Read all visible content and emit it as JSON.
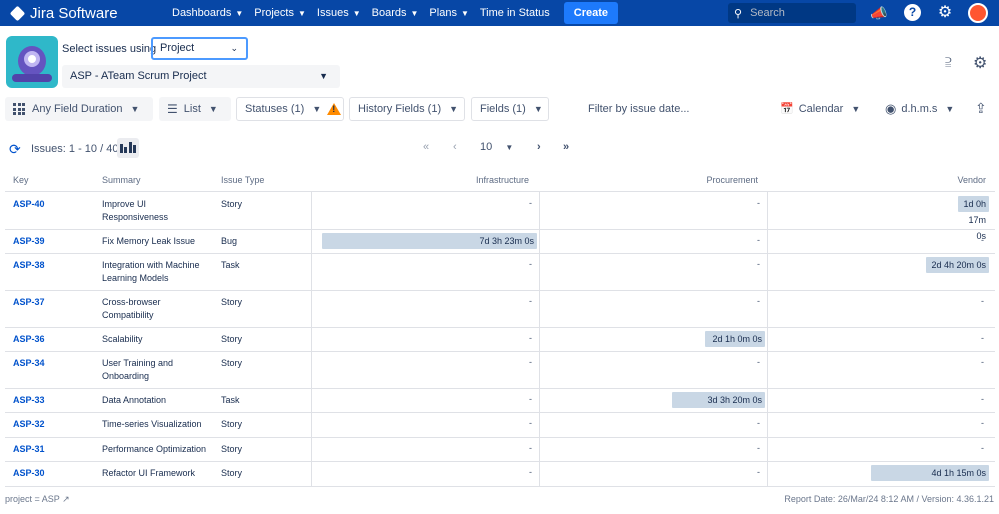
{
  "topnav": {
    "product": "Jira Software",
    "items": [
      "Dashboards",
      "Projects",
      "Issues",
      "Boards",
      "Plans"
    ],
    "time_in_status": "Time in Status",
    "create": "Create",
    "search_placeholder": "Search"
  },
  "header": {
    "select_label": "Select issues using",
    "select_value": "Project",
    "project": "ASP - ATeam Scrum Project"
  },
  "toolbar": {
    "duration": "Any Field Duration",
    "view": "List",
    "statuses": "Statuses (1)",
    "history_fields": "History Fields (1)",
    "fields": "Fields (1)",
    "filter_date": "Filter by issue date...",
    "calendar": "Calendar",
    "format": "d.h.m.s"
  },
  "pagination": {
    "issues": "Issues: 1 - 10 / 40",
    "page_size": "10"
  },
  "table": {
    "headers": [
      "Key",
      "Summary",
      "Issue Type",
      "Infrastructure",
      "Procurement",
      "Vendor"
    ],
    "rows": [
      {
        "key": "ASP-40",
        "summary": "Improve UI Responsiveness",
        "type": "Story",
        "infra": "-",
        "proc": "-",
        "vendor": "1d 0h 17m 0s",
        "infra_pct": 0,
        "proc_pct": 0,
        "vendor_pct": 0.14
      },
      {
        "key": "ASP-39",
        "summary": "Fix Memory Leak Issue",
        "type": "Bug",
        "infra": "7d 3h 23m 0s",
        "proc": "-",
        "vendor": "-",
        "infra_pct": 0.97,
        "proc_pct": 0,
        "vendor_pct": 0
      },
      {
        "key": "ASP-38",
        "summary": "Integration with Machine Learning Models",
        "type": "Task",
        "infra": "-",
        "proc": "-",
        "vendor": "2d 4h 20m 0s",
        "infra_pct": 0,
        "proc_pct": 0,
        "vendor_pct": 0.29
      },
      {
        "key": "ASP-37",
        "summary": "Cross-browser Compatibility",
        "type": "Story",
        "infra": "-",
        "proc": "-",
        "vendor": "-",
        "infra_pct": 0,
        "proc_pct": 0,
        "vendor_pct": 0
      },
      {
        "key": "ASP-36",
        "summary": "Scalability",
        "type": "Story",
        "infra": "-",
        "proc": "2d 1h 0m 0s",
        "vendor": "-",
        "infra_pct": 0,
        "proc_pct": 0.27,
        "vendor_pct": 0
      },
      {
        "key": "ASP-34",
        "summary": "User Training and Onboarding",
        "type": "Story",
        "infra": "-",
        "proc": "-",
        "vendor": "-",
        "infra_pct": 0,
        "proc_pct": 0,
        "vendor_pct": 0
      },
      {
        "key": "ASP-33",
        "summary": "Data Annotation",
        "type": "Task",
        "infra": "-",
        "proc": "3d 3h 20m 0s",
        "vendor": "-",
        "infra_pct": 0,
        "proc_pct": 0.42,
        "vendor_pct": 0
      },
      {
        "key": "ASP-32",
        "summary": "Time-series Visualization",
        "type": "Story",
        "infra": "-",
        "proc": "-",
        "vendor": "-",
        "infra_pct": 0,
        "proc_pct": 0,
        "vendor_pct": 0
      },
      {
        "key": "ASP-31",
        "summary": "Performance Optimization",
        "type": "Story",
        "infra": "-",
        "proc": "-",
        "vendor": "-",
        "infra_pct": 0,
        "proc_pct": 0,
        "vendor_pct": 0
      },
      {
        "key": "ASP-30",
        "summary": "Refactor UI Framework",
        "type": "Story",
        "infra": "-",
        "proc": "-",
        "vendor": "4d 1h 15m 0s",
        "infra_pct": 0,
        "proc_pct": 0,
        "vendor_pct": 0.54
      }
    ]
  },
  "footer": {
    "query": "project = ASP",
    "report": "Report Date: 26/Mar/24 8:12 AM / Version: 4.36.1.21"
  },
  "colors": {
    "nav": "#0747a6",
    "bar": "#c9d7e5",
    "link": "#0052cc"
  }
}
